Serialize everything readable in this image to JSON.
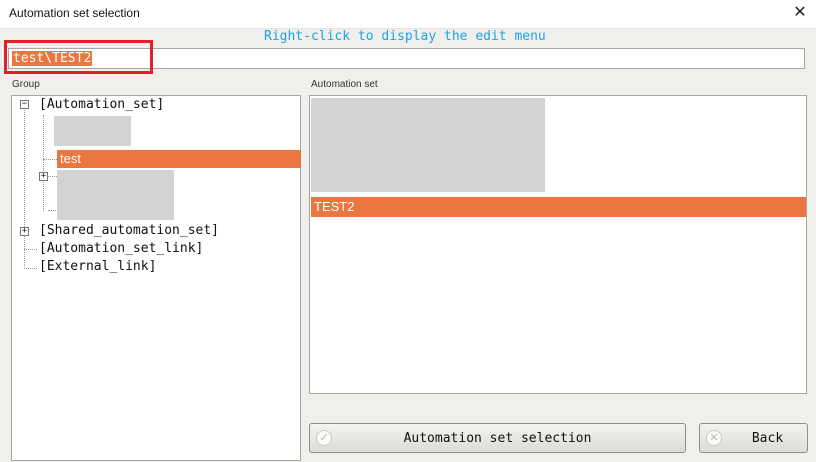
{
  "window": {
    "title": "Automation set selection",
    "close_glyph": "✕"
  },
  "hint": "Right-click to display the edit menu",
  "path_field": {
    "value": "test\\TEST2"
  },
  "group_panel": {
    "label": "Group",
    "tree": {
      "root": "[Automation_set]",
      "selected_child": "test",
      "expand_minus": "−",
      "expand_plus": "+",
      "others": [
        "[Shared_automation_set]",
        "[Automation_set_link]",
        "[External_link]"
      ]
    }
  },
  "automation_panel": {
    "label": "Automation set",
    "selected_item": "TEST2"
  },
  "buttons": {
    "select_label": "Automation set selection",
    "select_icon": "check-icon",
    "back_label": "Back",
    "back_icon": "cancel-icon"
  },
  "colors": {
    "selection": "#ec7640",
    "hint": "#1ca4e6",
    "highlight_box": "#e0212b"
  }
}
